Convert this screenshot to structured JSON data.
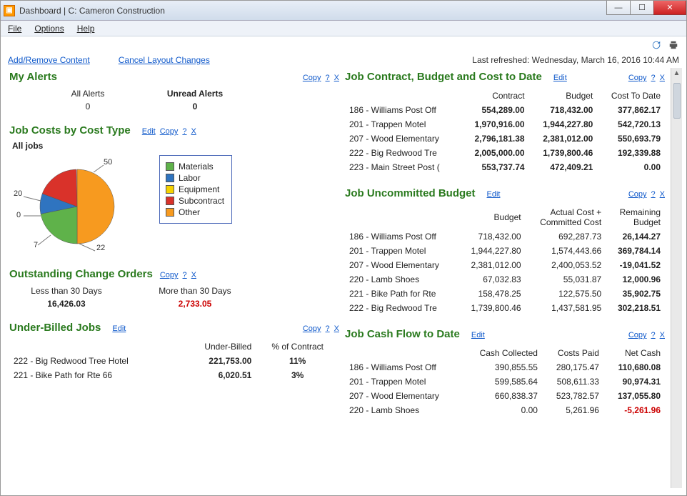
{
  "window": {
    "title": "Dashboard  |  C: Cameron Construction"
  },
  "menu": {
    "file": "File",
    "options": "Options",
    "help": "Help"
  },
  "links": {
    "add_remove": "Add/Remove Content",
    "cancel_layout": "Cancel Layout Changes",
    "last_refreshed": "Last refreshed:  Wednesday, March 16, 2016  10:44 AM",
    "edit": "Edit",
    "copy": "Copy",
    "q": "?",
    "x": "X"
  },
  "alerts": {
    "title": "My Alerts",
    "all_label": "All Alerts",
    "all_value": "0",
    "unread_label": "Unread Alerts",
    "unread_value": "0"
  },
  "job_costs": {
    "title": "Job Costs by Cost Type",
    "pie_title": "All jobs"
  },
  "chart_data": {
    "type": "pie",
    "title": "All jobs",
    "series": [
      {
        "name": "Materials",
        "value": 22,
        "color": "#5fb24a"
      },
      {
        "name": "Labor",
        "value": 7,
        "color": "#2f74c0"
      },
      {
        "name": "Equipment",
        "value": 0,
        "color": "#f5d200"
      },
      {
        "name": "Subcontract",
        "value": 20,
        "color": "#d9322a"
      },
      {
        "name": "Other",
        "value": 50,
        "color": "#f79a1f"
      }
    ],
    "legend_position": "right"
  },
  "change_orders": {
    "title": "Outstanding Change Orders",
    "col1_label": "Less than 30 Days",
    "col1_value": "16,426.03",
    "col2_label": "More than 30 Days",
    "col2_value": "2,733.05"
  },
  "under_billed": {
    "title": "Under-Billed Jobs",
    "headers": {
      "c1": "",
      "c2": "Under-Billed",
      "c3": "% of Contract"
    },
    "rows": [
      {
        "name": "222 - Big Redwood Tree Hotel",
        "ub": "221,753.00",
        "pct": "11%"
      },
      {
        "name": "221 - Bike Path for Rte 66",
        "ub": "6,020.51",
        "pct": "3%"
      }
    ]
  },
  "contract_budget": {
    "title": "Job Contract, Budget and Cost to Date",
    "headers": {
      "c1": "",
      "c2": "Contract",
      "c3": "Budget",
      "c4": "Cost To Date"
    },
    "rows": [
      {
        "name": "186 - Williams Post Off",
        "c": "554,289.00",
        "b": "718,432.00",
        "d": "377,862.17"
      },
      {
        "name": "201 - Trappen Motel",
        "c": "1,970,916.00",
        "b": "1,944,227.80",
        "d": "542,720.13"
      },
      {
        "name": "207 - Wood Elementary",
        "c": "2,796,181.38",
        "b": "2,381,012.00",
        "d": "550,693.79"
      },
      {
        "name": "222 - Big Redwood Tre",
        "c": "2,005,000.00",
        "b": "1,739,800.46",
        "d": "192,339.88"
      },
      {
        "name": "223 - Main Street Post (",
        "c": "553,737.74",
        "b": "472,409.21",
        "d": "0.00"
      }
    ]
  },
  "uncommitted": {
    "title": "Job Uncommitted Budget",
    "headers": {
      "c1": "",
      "c2": "Budget",
      "c3_a": "Actual Cost +",
      "c3_b": "Committed Cost",
      "c4_a": "Remaining",
      "c4_b": "Budget"
    },
    "rows": [
      {
        "name": "186 - Williams Post Off",
        "b": "718,432.00",
        "cc": "692,287.73",
        "r": "26,144.27"
      },
      {
        "name": "201 - Trappen Motel",
        "b": "1,944,227.80",
        "cc": "1,574,443.66",
        "r": "369,784.14"
      },
      {
        "name": "207 - Wood Elementary",
        "b": "2,381,012.00",
        "cc": "2,400,053.52",
        "r": "-19,041.52"
      },
      {
        "name": "220 - Lamb Shoes",
        "b": "67,032.83",
        "cc": "55,031.87",
        "r": "12,000.96"
      },
      {
        "name": "221 - Bike Path for Rte",
        "b": "158,478.25",
        "cc": "122,575.50",
        "r": "35,902.75"
      },
      {
        "name": "222 - Big Redwood Tre",
        "b": "1,739,800.46",
        "cc": "1,437,581.95",
        "r": "302,218.51"
      }
    ]
  },
  "cashflow": {
    "title": "Job Cash Flow to Date",
    "headers": {
      "c1": "",
      "c2": "Cash Collected",
      "c3": "Costs Paid",
      "c4": "Net Cash"
    },
    "rows": [
      {
        "name": "186 - Williams Post Off",
        "cc": "390,855.55",
        "cp": "280,175.47",
        "n": "110,680.08"
      },
      {
        "name": "201 - Trappen Motel",
        "cc": "599,585.64",
        "cp": "508,611.33",
        "n": "90,974.31"
      },
      {
        "name": "207 - Wood Elementary",
        "cc": "660,838.37",
        "cp": "523,782.57",
        "n": "137,055.80"
      },
      {
        "name": "220 - Lamb Shoes",
        "cc": "0.00",
        "cp": "5,261.96",
        "n": "-5,261.96",
        "neg": true
      }
    ]
  }
}
